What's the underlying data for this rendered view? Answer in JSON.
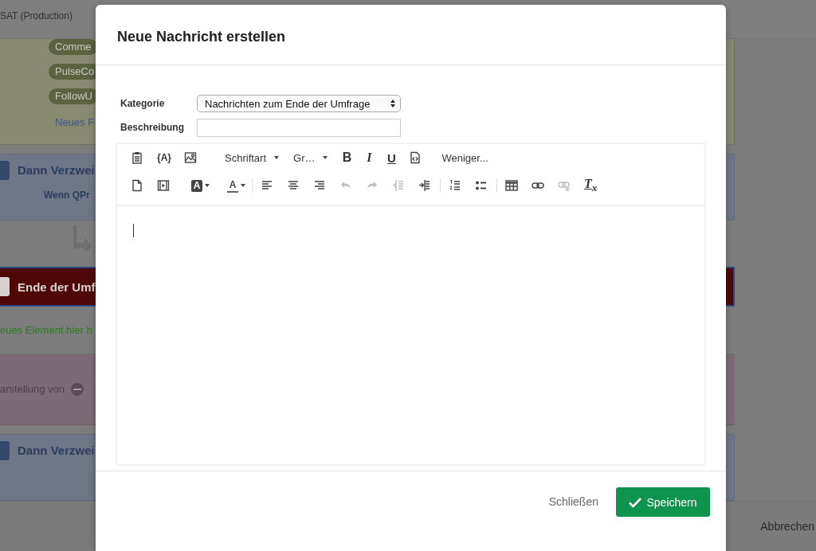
{
  "background": {
    "header_title": "SAT (Production)",
    "tags": [
      "Comme",
      "PulseCo",
      "FollowU"
    ],
    "add_field_link": "Neues F",
    "blocks": [
      {
        "kind": "branch",
        "title": "Dann Verzwei",
        "condition": "Wenn  QPr"
      },
      {
        "kind": "arrow"
      },
      {
        "kind": "end",
        "title": "Ende der Umf"
      },
      {
        "kind": "drop",
        "text": "eues Element hier h"
      },
      {
        "kind": "display",
        "text": "arstellung von"
      },
      {
        "kind": "branch",
        "title": "Dann Verzwei"
      }
    ],
    "cancel": "Abbrechen"
  },
  "dialog": {
    "title": "Neue Nachricht erstellen",
    "fields": [
      {
        "kind": "select",
        "label": "Kategorie",
        "value": "Nachrichten zum Ende der Umfrage"
      },
      {
        "kind": "text",
        "label": "Beschreibung"
      }
    ],
    "toolbar": [
      [
        {
          "kind": "icon",
          "disabled": false
        },
        {
          "kind": "glyph",
          "text": "{A}",
          "disabled": false
        },
        {
          "kind": "icon",
          "disabled": false
        },
        {
          "kind": "dropdown",
          "text": "Schriftart"
        },
        {
          "kind": "dropdown",
          "text": "Gr…"
        },
        {
          "kind": "glyph",
          "text": "B",
          "disabled": false
        },
        {
          "kind": "glyph",
          "text": "I",
          "disabled": false
        },
        {
          "kind": "glyph",
          "text": "U",
          "disabled": false
        },
        {
          "kind": "icon",
          "disabled": false
        },
        {
          "kind": "text",
          "text": "Weniger..."
        }
      ],
      [
        {
          "kind": "icon",
          "disabled": false
        },
        {
          "kind": "icon",
          "disabled": false
        },
        {
          "kind": "color",
          "text": "A"
        },
        {
          "kind": "color",
          "text": "A"
        },
        {
          "kind": "separator"
        },
        {
          "kind": "icon",
          "disabled": false
        },
        {
          "kind": "icon",
          "disabled": false
        },
        {
          "kind": "icon",
          "disabled": false
        },
        {
          "kind": "icon",
          "disabled": true
        },
        {
          "kind": "icon",
          "disabled": true
        },
        {
          "kind": "icon",
          "disabled": true
        },
        {
          "kind": "icon",
          "disabled": false
        },
        {
          "kind": "separator"
        },
        {
          "kind": "icon",
          "disabled": false
        },
        {
          "kind": "icon",
          "disabled": false
        },
        {
          "kind": "separator"
        },
        {
          "kind": "icon",
          "disabled": false
        },
        {
          "kind": "icon",
          "disabled": false
        },
        {
          "kind": "icon",
          "disabled": true
        },
        {
          "kind": "glyph",
          "text": "T$_{x}$",
          "disabled": false
        }
      ]
    ],
    "buttons": [
      {
        "kind": "link",
        "label": "Schließen"
      },
      {
        "kind": "primary",
        "label": "Speichern"
      }
    ]
  }
}
